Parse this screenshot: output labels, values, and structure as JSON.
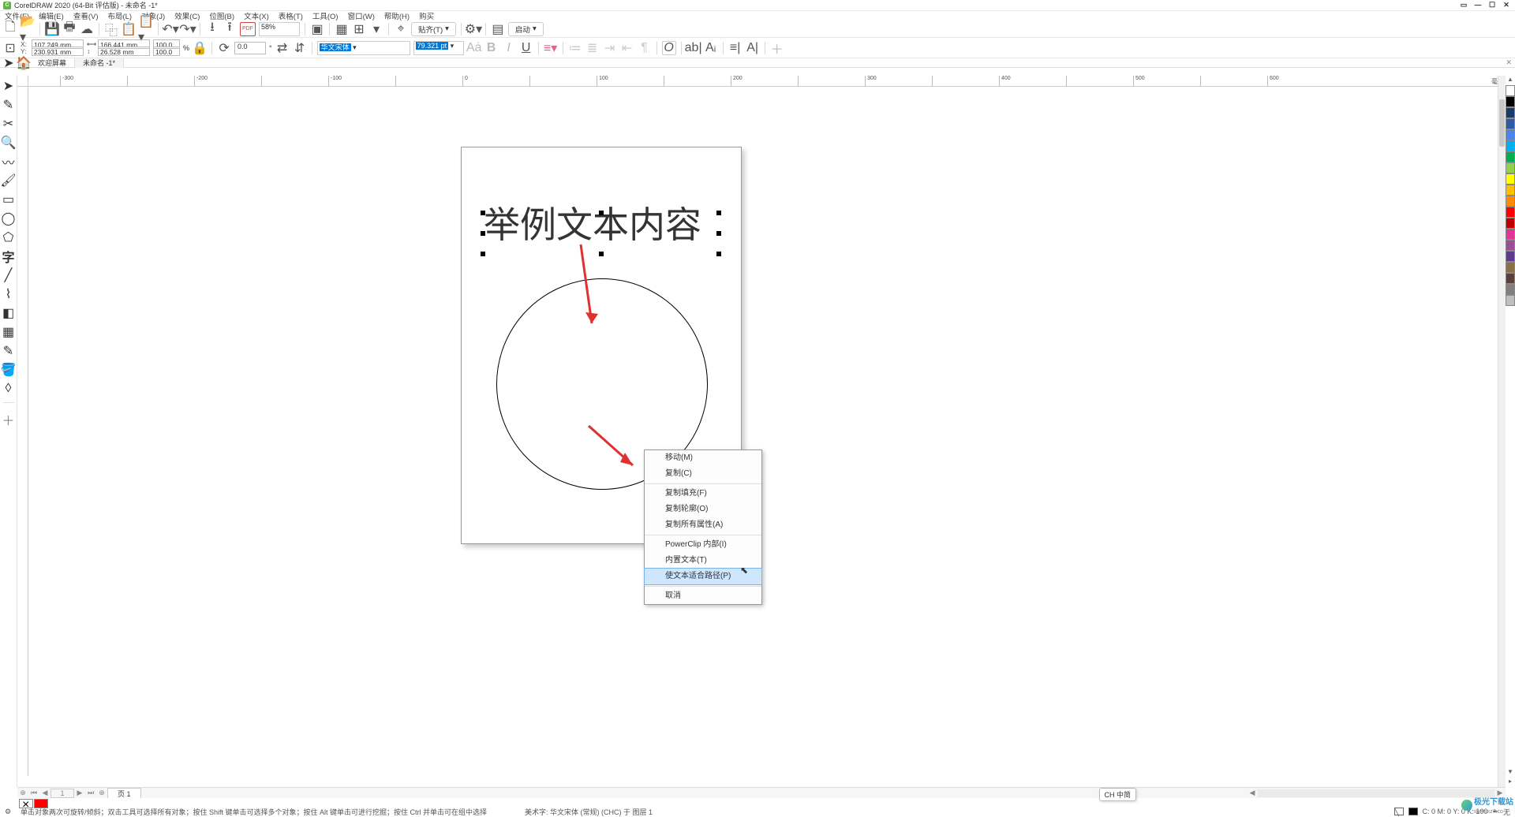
{
  "title": "CorelDRAW 2020 (64-Bit 评估版) - 未命名 -1*",
  "menus": [
    "文件(F)",
    "编辑(E)",
    "查看(V)",
    "布局(L)",
    "对象(J)",
    "效果(C)",
    "位图(B)",
    "文本(X)",
    "表格(T)",
    "工具(O)",
    "窗口(W)",
    "帮助(H)",
    "购买"
  ],
  "toolbar1": {
    "zoom": "58%",
    "align_label": "贴齐(T)",
    "launch_label": "启动"
  },
  "propbar": {
    "x": "107.249 mm",
    "y": "230.931 mm",
    "w": "166.441 mm",
    "h": "26.528 mm",
    "sx": "100.0",
    "sy": "100.0",
    "pct": "%",
    "rot": "0.0",
    "rotunit": "°",
    "font": "华文宋体",
    "fontsize": "79.321 pt"
  },
  "tabs": {
    "welcome": "欢迎屏幕",
    "doc": "未命名 -1*"
  },
  "ruler_unit": "毫米",
  "ruler_ticks": [
    "-300",
    "",
    "-200",
    "",
    "-100",
    "",
    "0",
    "",
    "100",
    "",
    "200",
    "",
    "300",
    "",
    "400",
    "",
    "500",
    "",
    "600"
  ],
  "ruler_pos": [
    -300,
    -250,
    -200,
    -150,
    -100,
    -50,
    0,
    50,
    100,
    150,
    200,
    250,
    300,
    350,
    400,
    450,
    500,
    550,
    600
  ],
  "canvas": {
    "text": "举例文本内容"
  },
  "context_menu": {
    "items": [
      "移动(M)",
      "复制(C)",
      "—",
      "复制填充(F)",
      "复制轮廓(O)",
      "复制所有属性(A)",
      "—",
      "PowerClip 内部(I)",
      "内置文本(T)",
      "使文本适合路径(P)",
      "—",
      "取消"
    ],
    "highlighted": "使文本适合路径(P)"
  },
  "page_nav": {
    "page_label": "页 1"
  },
  "palette_colors": [
    "#ffffff",
    "#000000",
    "#1b3a6b",
    "#2e5aa7",
    "#4a86e8",
    "#00b0f0",
    "#00b050",
    "#92d050",
    "#ffff00",
    "#ffc000",
    "#ff8c00",
    "#ff0000",
    "#c00000",
    "#e03796",
    "#9b4f96",
    "#603a8c",
    "#8b6f47",
    "#5d4037",
    "#808080",
    "#bfbfbf"
  ],
  "color_row": {
    "none_label": "×",
    "fill": "#ff0000"
  },
  "ime": "CH 中简",
  "status": {
    "hint": "单击对象两次可旋转/倾斜；双击工具可选择所有对象；按住 Shift 键单击可选择多个对象；按住 Alt 键单击可进行挖掘；按住 Ctrl 并单击可在组中选择",
    "obj": "美术字: 华文宋体 (常规) (CHC) 于 图层 1",
    "cmyk": "C: 0 M: 0 Y: 0 K: 100",
    "fill_none": "无"
  },
  "watermark": {
    "name": "极光下载站",
    "url": "www.xz7.co"
  }
}
